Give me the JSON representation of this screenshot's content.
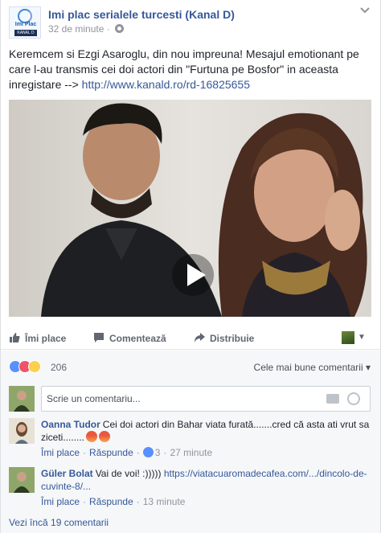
{
  "post": {
    "page_name": "Imi plac serialele turcesti (Kanal D)",
    "logo_text": "Imi Plac",
    "logo_sub": "KANAL D",
    "time": "32 de minute",
    "text": "Keremcem si Ezgi Asaroglu, din nou impreuna! Mesajul emotionant pe care l-au transmis cei doi actori din \"Furtuna pe Bosfor\" in aceasta inregistare --> ",
    "link": "http://www.kanald.ro/rd-16825655"
  },
  "actions": {
    "like": "Îmi place",
    "comment": "Comentează",
    "share": "Distribuie"
  },
  "reactions": {
    "count": "206",
    "sort_label": "Cele mai bune comentarii"
  },
  "composer": {
    "placeholder": "Scrie un comentariu..."
  },
  "comments": [
    {
      "name": "Oanna Tudor",
      "text": "Cei doi actori din Bahar viata furată.......cred că asta ati vrut sa ziceti........",
      "like": "Îmi place",
      "reply": "Răspunde",
      "likes": "3",
      "time": "27 minute"
    },
    {
      "name": "Güler Bolat",
      "text": "Vai de voi! :))))) ",
      "link": "https://viatacuaromadecafea.com/.../dincolo-de-cuvinte-8/...",
      "like": "Îmi place",
      "reply": "Răspunde",
      "time": "13 minute"
    }
  ],
  "more_comments": "Vezi încă 19 comentarii"
}
